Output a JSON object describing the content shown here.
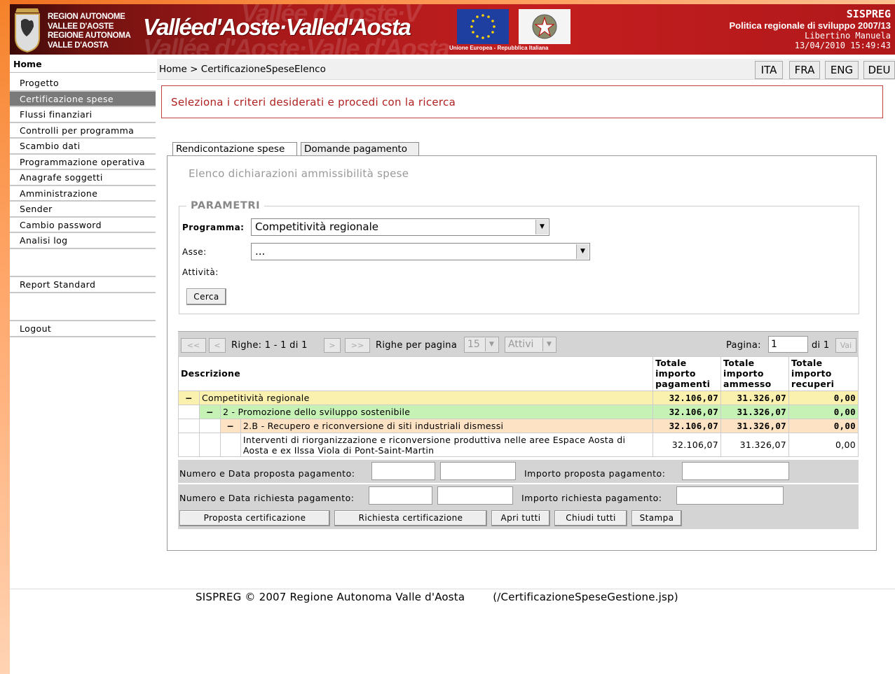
{
  "header": {
    "region_lines": [
      "REGION AUTONOME",
      "VALLEE D'AOSTE",
      "REGIONE AUTONOMA",
      "VALLE D'AOSTA"
    ],
    "title": "Valléed'Aoste·Valled'Aosta",
    "flags_caption": "Unione Europea - Repubblica Italiana",
    "app_name": "SISPREG",
    "app_subtitle": "Politica regionale di sviluppo 2007/13",
    "user": "Libertino Manuela",
    "datetime": "13/04/2010 15:49:43"
  },
  "sidebar": {
    "home": "Home",
    "items": [
      {
        "label": "Progetto"
      },
      {
        "label": "Certificazione spese"
      },
      {
        "label": "Flussi finanziari"
      },
      {
        "label": "Controlli per programma"
      },
      {
        "label": "Scambio dati"
      },
      {
        "label": "Programmazione operativa"
      },
      {
        "label": "Anagrafe soggetti"
      },
      {
        "label": "Amministrazione"
      },
      {
        "label": "Sender"
      },
      {
        "label": "Cambio password"
      },
      {
        "label": "Analisi log"
      }
    ],
    "report": "Report Standard",
    "logout": "Logout"
  },
  "breadcrumb": "Home > CertificazioneSpeseElenco",
  "languages": [
    "ITA",
    "FRA",
    "ENG",
    "DEU"
  ],
  "message": "Seleziona i criteri desiderati e procedi con la ricerca",
  "tabs": [
    "Rendicontazione spese",
    "Domande pagamento"
  ],
  "panel_title": "Elenco dichiarazioni ammissibilità spese",
  "parametri": {
    "legend": "PARAMETRI",
    "programma_label": "Programma:",
    "programma_value": "Competitività regionale",
    "asse_label": "Asse:",
    "asse_value": "...",
    "attivita_label": "Attività:",
    "cerca": "Cerca"
  },
  "pager": {
    "first": "<<",
    "prev": "<",
    "rows_text": "Righe: 1 - 1 di 1",
    "next": ">",
    "last": ">>",
    "per_page_label": "Righe per pagina",
    "per_page_value": "15",
    "filter_value": "Attivi",
    "page_label": "Pagina:",
    "page_value": "1",
    "of_pages": "di 1",
    "go": "Vai"
  },
  "table": {
    "headers": {
      "descrizione": "Descrizione",
      "tot_pagamenti": "Totale importo pagamenti",
      "tot_ammesso": "Totale importo ammesso",
      "tot_recuperi": "Totale importo recuperi"
    },
    "rows": [
      {
        "toggle": "−",
        "desc": "Competitività regionale",
        "pag": "32.106,07",
        "amm": "31.326,07",
        "rec": "0,00"
      },
      {
        "toggle": "−",
        "desc": "2 - Promozione dello sviluppo sostenibile",
        "pag": "32.106,07",
        "amm": "31.326,07",
        "rec": "0,00"
      },
      {
        "toggle": "−",
        "desc": "2.B - Recupero e riconversione di siti industriali dismessi",
        "pag": "32.106,07",
        "amm": "31.326,07",
        "rec": "0,00"
      },
      {
        "desc": "Interventi di riorganizzazione e riconversione produttiva nelle aree Espace Aosta di Aosta e ex Ilssa Viola di Pont-Saint-Martin",
        "pag": "32.106,07",
        "amm": "31.326,07",
        "rec": "0,00"
      }
    ]
  },
  "form": {
    "proposta_label": "Numero e Data proposta pagamento:",
    "importo_proposta_label": "Importo proposta pagamento:",
    "richiesta_label": "Numero e Data richiesta pagamento:",
    "importo_richiesta_label": "Importo richiesta pagamento:"
  },
  "actions": [
    "Proposta certificazione",
    "Richiesta certificazione",
    "Apri tutti",
    "Chiudi tutti",
    "Stampa"
  ],
  "footer": {
    "copyright": "SISPREG © 2007 Regione Autonoma Valle d'Aosta",
    "path": "(/CertificazioneSpeseGestione.jsp)"
  }
}
